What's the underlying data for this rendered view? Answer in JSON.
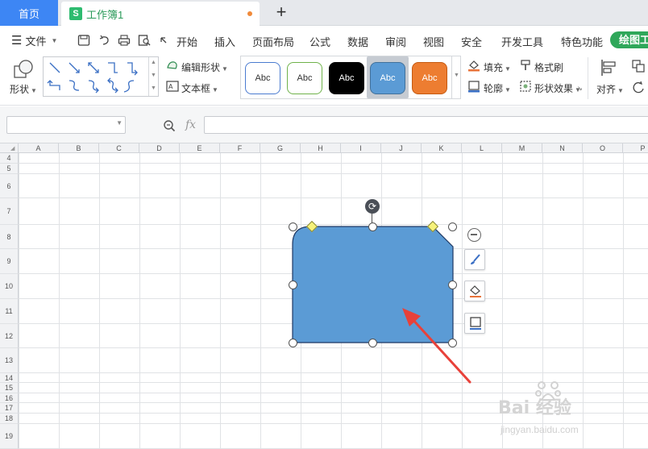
{
  "tabs": {
    "home": "首页",
    "document": "工作簿1",
    "doc_icon": "S",
    "add": "+"
  },
  "menu": {
    "file": "文件",
    "items": [
      "开始",
      "插入",
      "页面布局",
      "公式",
      "数据",
      "审阅",
      "视图",
      "安全",
      "开发工具",
      "特色功能"
    ],
    "active": "绘图工"
  },
  "ribbon": {
    "shape_label": "形状",
    "edit_shape": "编辑形状",
    "text_box": "文本框",
    "styles": [
      {
        "label": "Abc",
        "fill": "#ffffff",
        "border": "#4a7bd0",
        "text": "#333333"
      },
      {
        "label": "Abc",
        "fill": "#ffffff",
        "border": "#6fb24a",
        "text": "#333333"
      },
      {
        "label": "Abc",
        "fill": "#000000",
        "border": "#000000",
        "text": "#ffffff"
      },
      {
        "label": "Abc",
        "fill": "#5b9bd5",
        "border": "#41719c",
        "text": "#ffffff"
      },
      {
        "label": "Abc",
        "fill": "#ed7d31",
        "border": "#c55a11",
        "text": "#ffffff"
      }
    ],
    "fill": "填充",
    "format_painter": "格式刷",
    "outline": "轮廓",
    "shape_effects": "形状效果",
    "align": "对齐"
  },
  "formula_bar": {
    "name_box": "",
    "fx": "fx",
    "formula": ""
  },
  "columns": [
    "A",
    "B",
    "C",
    "D",
    "E",
    "F",
    "G",
    "H",
    "I",
    "J",
    "K",
    "L",
    "M",
    "N",
    "O",
    "P"
  ],
  "rows": [
    "4",
    "5",
    "6",
    "7",
    "8",
    "9",
    "10",
    "11",
    "12",
    "13",
    "14",
    "15",
    "16",
    "17",
    "18",
    "19"
  ],
  "shape": {
    "fill": "#5b9bd5",
    "border": "#1f3864"
  },
  "accent": {
    "tab_blue": "#3d86f4",
    "active_green": "#2fa75a",
    "arrow_red": "#e8413a"
  },
  "watermark": {
    "main": "Bai 经验",
    "sub": "jingyan.baidu.com"
  }
}
